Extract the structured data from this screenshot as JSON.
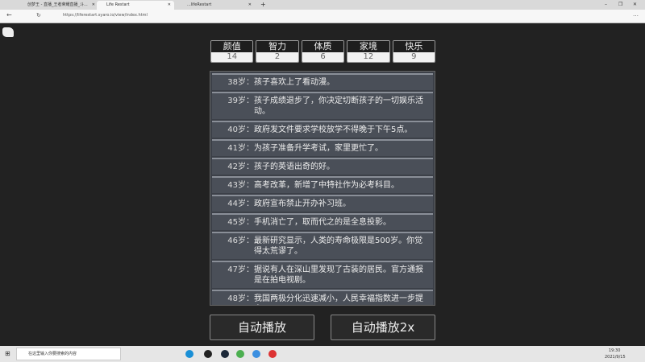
{
  "browser": {
    "tabs": [
      {
        "label": "创梦王 - 直播_王者荣耀直播_斗..."
      },
      {
        "label": "Life Restart"
      },
      {
        "label": "...lifeRestart"
      }
    ],
    "new_tab": "+",
    "url": "https://liferestart.syaro.io/view/index.html",
    "window_controls": {
      "minimize": "–",
      "restore": "❐",
      "close": "✕"
    }
  },
  "stats": [
    {
      "label": "颜值",
      "value": "14"
    },
    {
      "label": "智力",
      "value": "2"
    },
    {
      "label": "体质",
      "value": "6"
    },
    {
      "label": "家境",
      "value": "12"
    },
    {
      "label": "快乐",
      "value": "9"
    }
  ],
  "events": [
    {
      "age": "38岁：",
      "text": "孩子喜欢上了看动漫。"
    },
    {
      "age": "39岁：",
      "text": "孩子成绩退步了，你决定切断孩子的一切娱乐活动。"
    },
    {
      "age": "40岁：",
      "text": "政府发文件要求学校放学不得晚于下午5点。"
    },
    {
      "age": "41岁：",
      "text": "为孩子准备升学考试，家里更忙了。"
    },
    {
      "age": "42岁：",
      "text": "孩子的英语出奇的好。"
    },
    {
      "age": "43岁：",
      "text": "高考改革，新增了中特社作为必考科目。"
    },
    {
      "age": "44岁：",
      "text": "政府宣布禁止开办补习班。"
    },
    {
      "age": "45岁：",
      "text": "手机消亡了，取而代之的是全息投影。"
    },
    {
      "age": "46岁：",
      "text": "最新研究显示，人类的寿命极限是500岁。你觉得太荒谬了。"
    },
    {
      "age": "47岁：",
      "text": "据说有人在深山里发现了古装的居民。官方通报是在拍电视剧。"
    },
    {
      "age": "48岁：",
      "text": "我国两极分化迅速减小，人民幸福指数进一步提高。"
    }
  ],
  "buttons": {
    "auto_play": "自动播放",
    "auto_play_2x": "自动播放2x"
  },
  "taskbar": {
    "search_placeholder": "在这里输入你要搜索的内容",
    "time": "19:30",
    "date": "2021/9/15"
  }
}
